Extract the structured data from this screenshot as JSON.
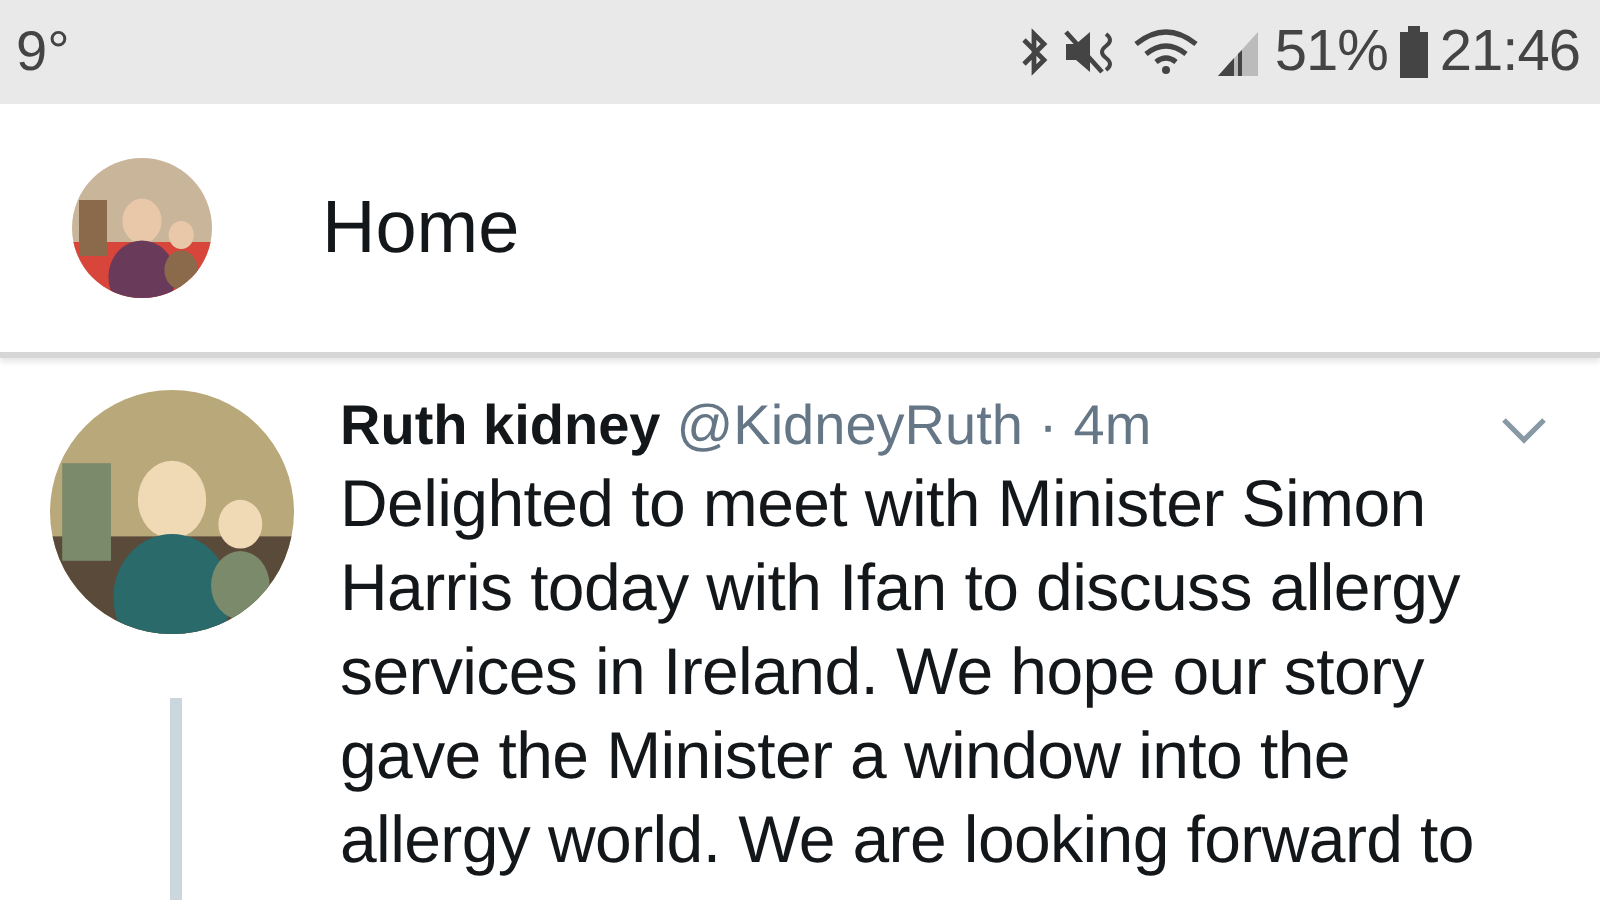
{
  "status_bar": {
    "temperature": "9°",
    "battery": "51%",
    "time": "21:46"
  },
  "header": {
    "title": "Home"
  },
  "tweet": {
    "name": "Ruth kidney",
    "handle": "@KidneyRuth",
    "separator": "·",
    "time": "4m",
    "text": "Delighted to meet with Minister Simon Harris today with Ifan to discuss allergy services in Ireland. We hope our story gave the Minister a window into the allergy world. We are looking forward to",
    "thread": true
  }
}
